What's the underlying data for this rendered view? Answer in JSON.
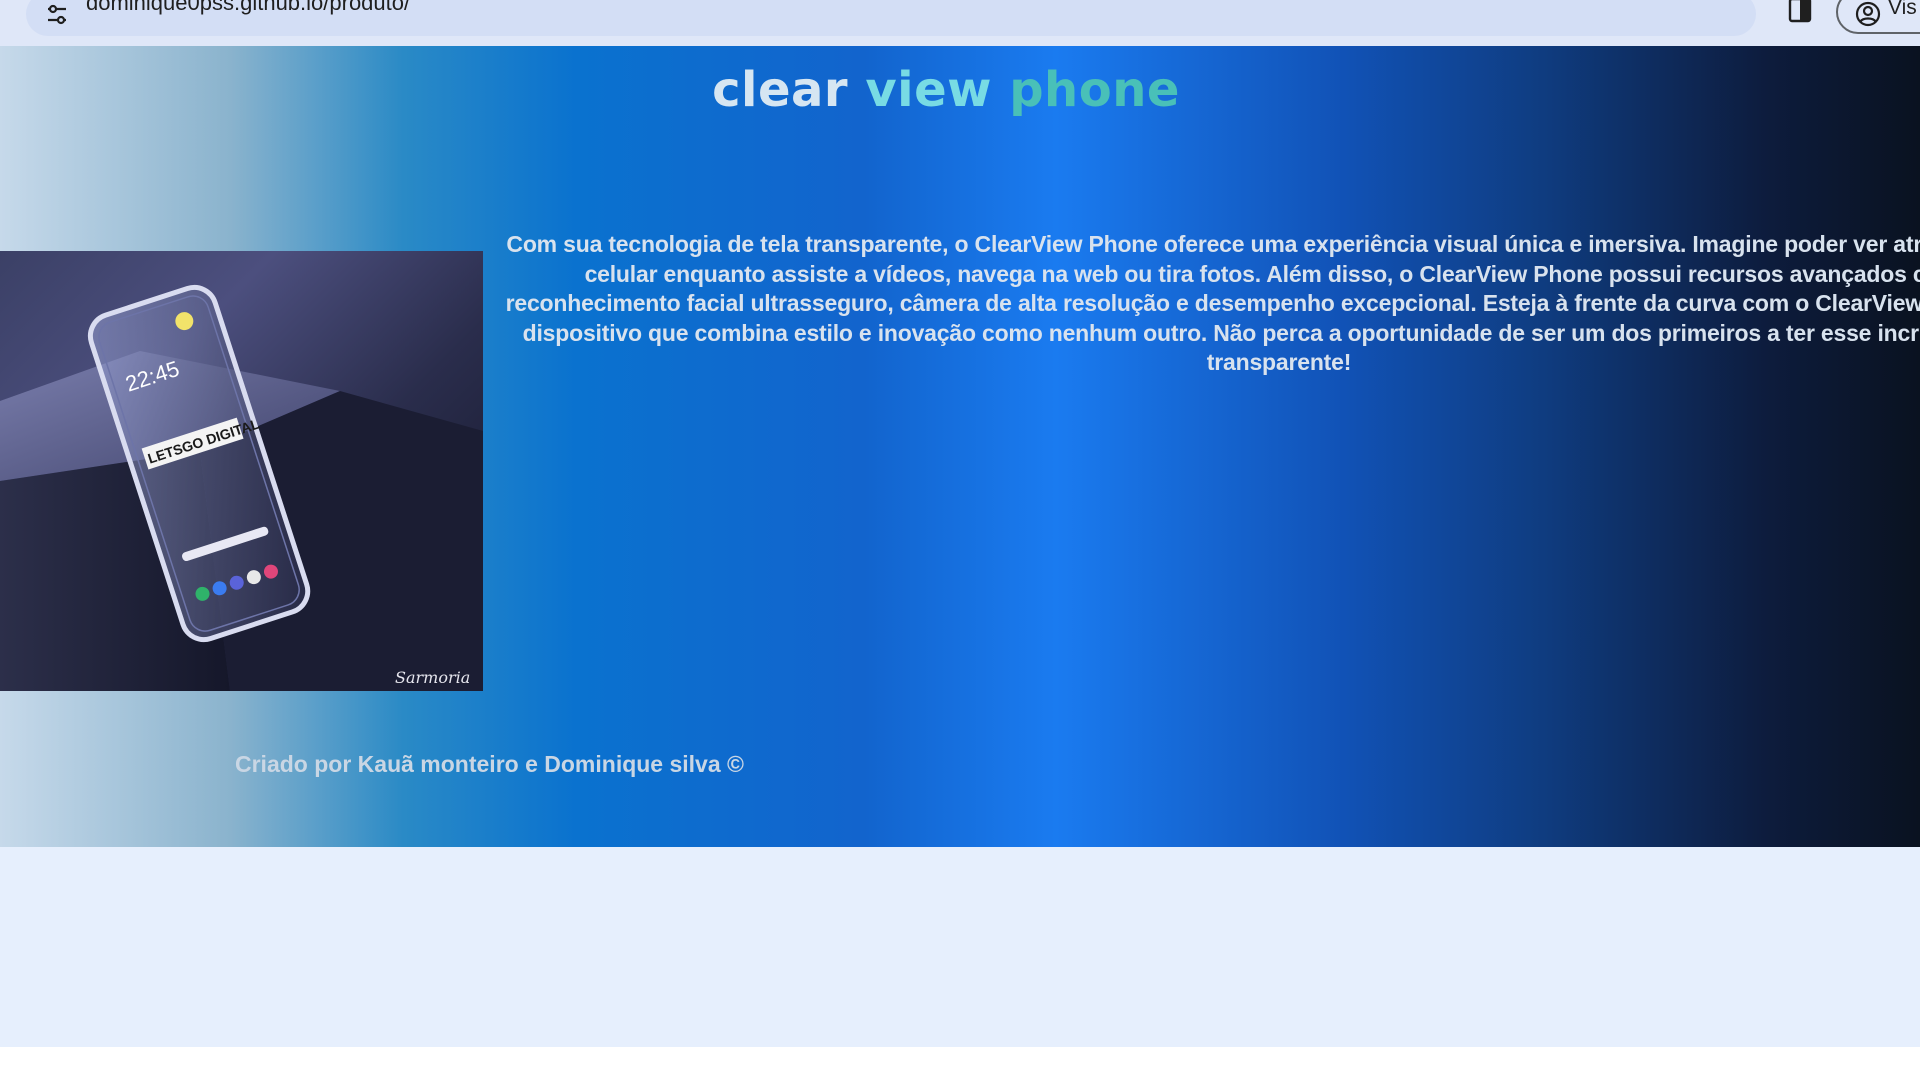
{
  "browser": {
    "url": "dominique0pss.github.io/produto/",
    "profile_label": "Vis"
  },
  "page": {
    "title_words": [
      "clear",
      "view",
      "phone"
    ],
    "description": "Com sua tecnologia de tela transparente, o ClearView Phone oferece uma experiência visual única e imersiva. Imagine poder ver através do seu celular enquanto assiste a vídeos, navega na web ou tira fotos. Além disso, o ClearView Phone possui recursos avançados como reconhecimento facial ultrasseguro, câmera de alta resolução e desempenho excepcional. Esteja à frente da curva com o ClearView Phone - um dispositivo que combina estilo e inovação como nenhum outro. Não perca a oportunidade de ser um dos primeiros a ter esse incrível celular transparente!",
    "footer": "Criado por Kauã monteiro e Dominique silva ©",
    "product_image": {
      "time": "22:45",
      "banner": "LETSGO DIGITAL",
      "signature": "Sarmoria"
    }
  },
  "colors": {
    "title_word_1": "#d6e6f2",
    "title_word_2": "#78dbe4",
    "title_word_3": "#49c0b8",
    "hero_gradient_mid": "#1a7bf0",
    "hero_gradient_end": "#0a1220",
    "below_page": "#e6effd"
  },
  "icons": [
    "site-settings-icon",
    "side-panel-icon",
    "profile-icon"
  ]
}
